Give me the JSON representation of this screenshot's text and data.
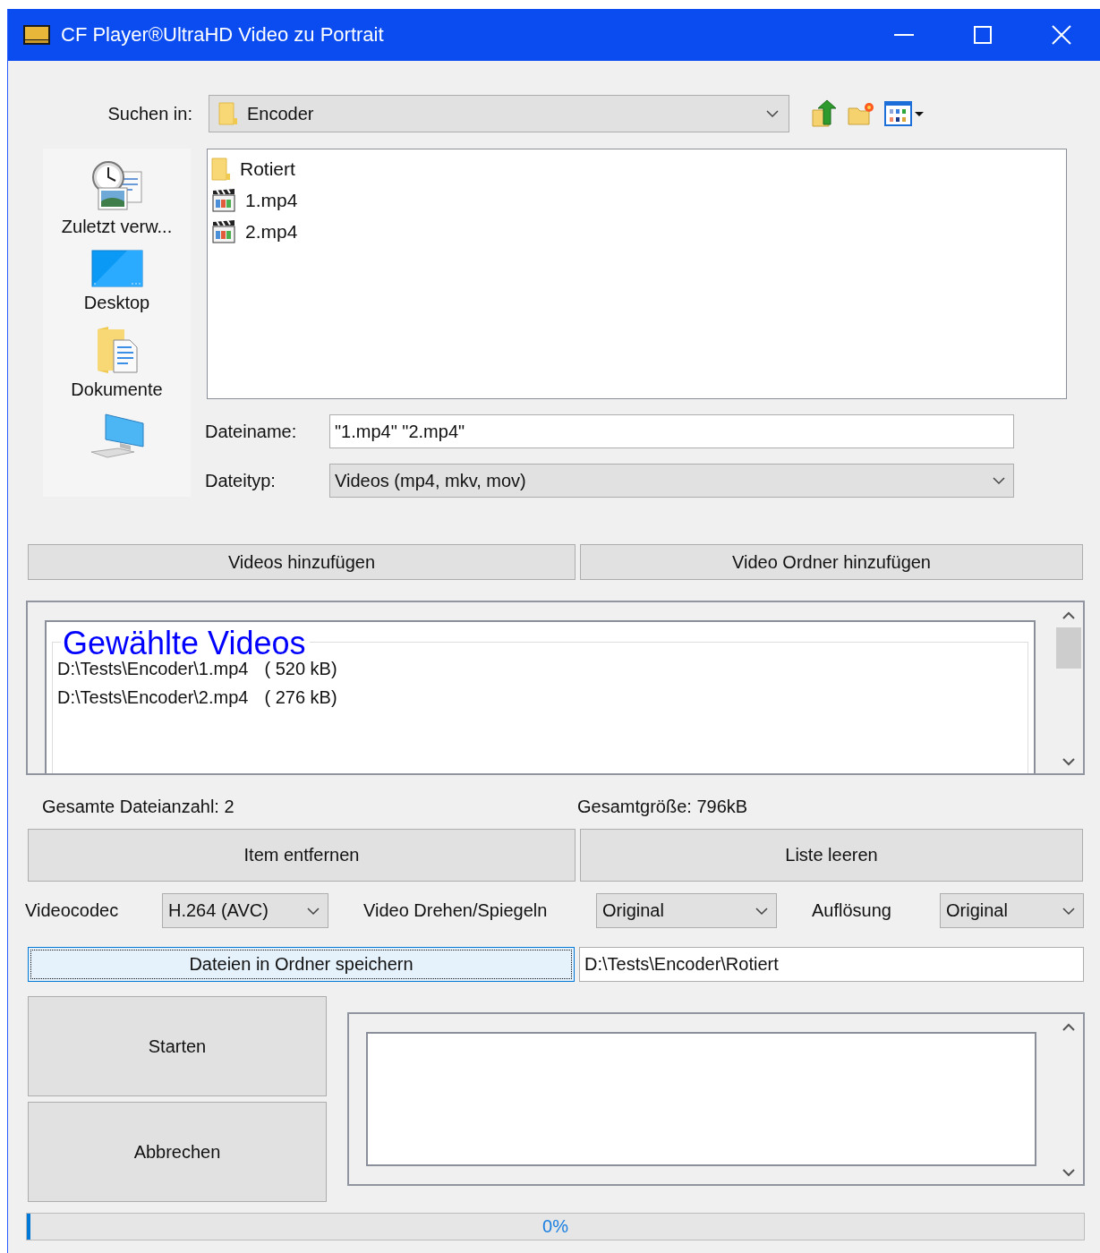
{
  "window": {
    "title": "CF Player®UltraHD Video zu Portrait"
  },
  "look_in": {
    "label": "Suchen in:",
    "value": "Encoder"
  },
  "places": [
    {
      "kind": "recent",
      "label": "Zuletzt verw..."
    },
    {
      "kind": "desktop",
      "label": "Desktop"
    },
    {
      "kind": "documents",
      "label": "Dokumente"
    },
    {
      "kind": "computer"
    }
  ],
  "files": [
    {
      "kind": "folder",
      "name": "Rotiert"
    },
    {
      "kind": "video",
      "name": "1.mp4"
    },
    {
      "kind": "video",
      "name": "2.mp4"
    }
  ],
  "file_name": {
    "label": "Dateiname:",
    "value": "\"1.mp4\" \"2.mp4\""
  },
  "file_type": {
    "label": "Dateityp:",
    "value": "Videos (mp4, mkv, mov)"
  },
  "add_buttons": [
    "Videos hinzufügen",
    "Video Ordner hinzufügen"
  ],
  "selected_videos": {
    "title": "Gewählte Videos",
    "items": [
      {
        "path": "D:\\Tests\\Encoder\\1.mp4",
        "size": "( 520 kB)"
      },
      {
        "path": "D:\\Tests\\Encoder\\2.mp4",
        "size": "( 276 kB)"
      }
    ]
  },
  "stats": {
    "file_count": "Gesamte Dateianzahl: 2",
    "total_size": "Gesamtgröße: 796kB"
  },
  "list_buttons": [
    "Item entfernen",
    "Liste leeren"
  ],
  "options": [
    {
      "label": "Videocodec",
      "value": "H.264 (AVC)"
    },
    {
      "label": "Video Drehen/Spiegeln",
      "value": "Original"
    },
    {
      "label": "Auflösung",
      "value": "Original"
    }
  ],
  "save": {
    "button": "Dateien in Ordner speichern",
    "focused": true,
    "path": "D:\\Tests\\Encoder\\Rotiert"
  },
  "action_buttons": [
    "Starten",
    "Abbrechen"
  ],
  "progress": {
    "level": 0,
    "reading": "0%"
  }
}
